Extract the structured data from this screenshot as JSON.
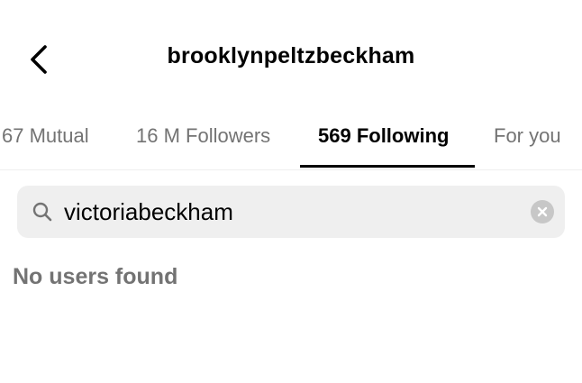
{
  "header": {
    "title": "brooklynpeltzbeckham",
    "back_icon": "chevron-left-icon"
  },
  "tabs": [
    {
      "label": "67 Mutual",
      "active": false
    },
    {
      "label": "16 M Followers",
      "active": false
    },
    {
      "label": "569 Following",
      "active": true
    },
    {
      "label": "For you",
      "active": false
    }
  ],
  "search": {
    "value": "victoriabeckham",
    "icon": "search-icon",
    "clear_icon": "clear-icon"
  },
  "results": {
    "empty_message": "No users found"
  },
  "colors": {
    "primary_text": "#000000",
    "secondary_text": "#737373",
    "search_background": "#efefef",
    "clear_button": "#c7c7c7"
  }
}
